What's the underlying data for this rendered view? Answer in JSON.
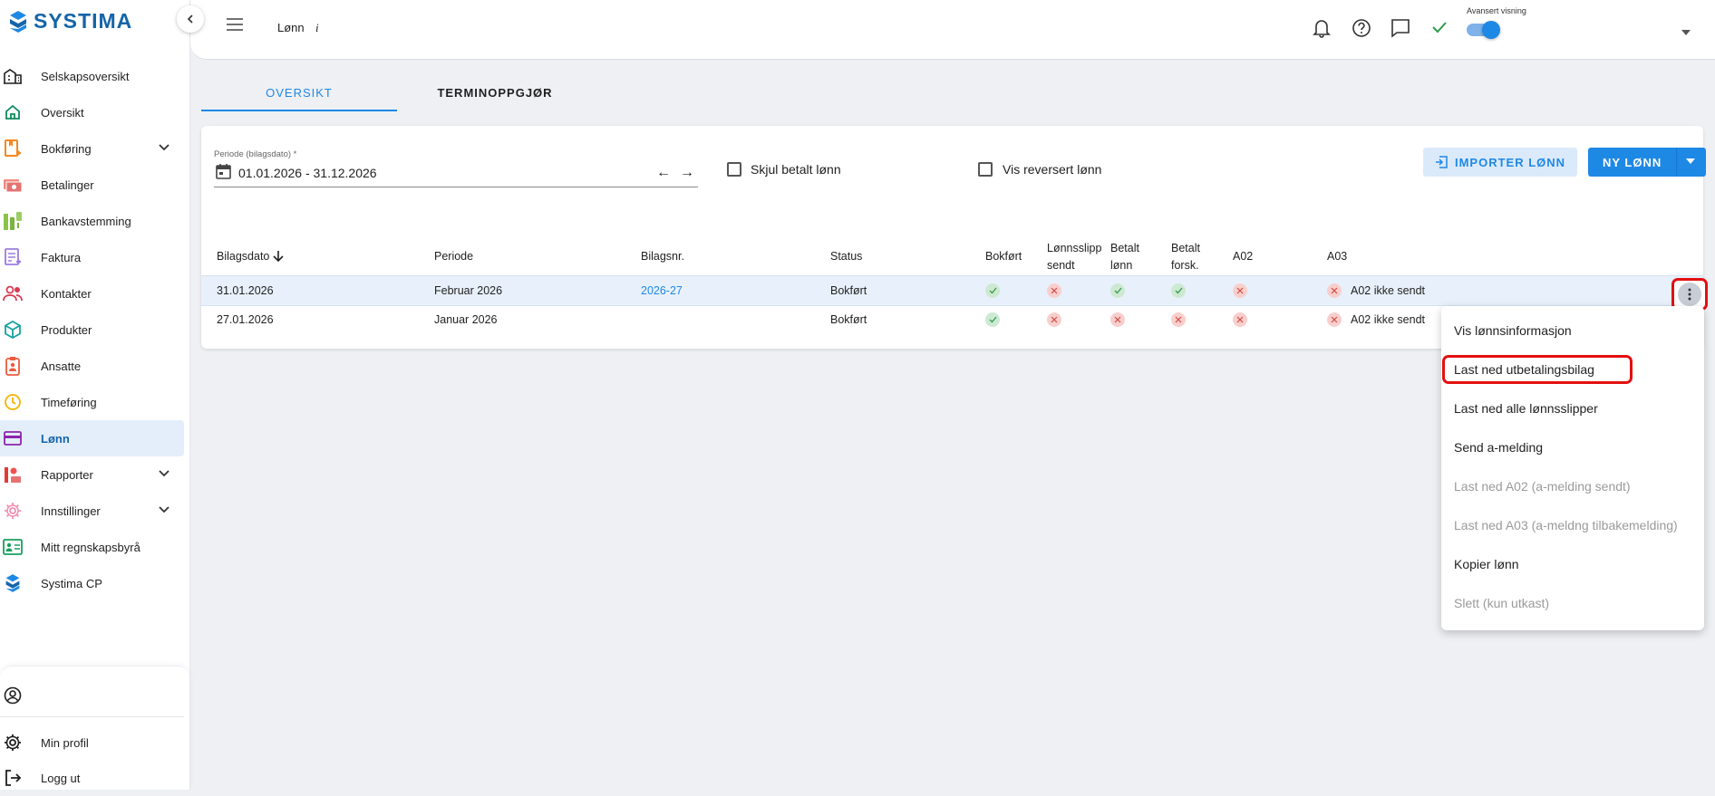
{
  "app": {
    "logo_text": "SYSTIMA",
    "accent_color": "#1e88e5"
  },
  "sidebar": {
    "items": [
      {
        "label": "Selskapsoversikt",
        "icon": "buildings-icon"
      },
      {
        "label": "Oversikt",
        "icon": "home-icon"
      },
      {
        "label": "Bokføring",
        "icon": "ledger-icon",
        "expandable": true
      },
      {
        "label": "Betalinger",
        "icon": "payments-icon"
      },
      {
        "label": "Bankavstemming",
        "icon": "bank-reconcile-icon"
      },
      {
        "label": "Faktura",
        "icon": "invoice-icon"
      },
      {
        "label": "Kontakter",
        "icon": "contacts-icon"
      },
      {
        "label": "Produkter",
        "icon": "cube-icon"
      },
      {
        "label": "Ansatte",
        "icon": "badge-icon"
      },
      {
        "label": "Timeføring",
        "icon": "clock-icon"
      },
      {
        "label": "Lønn",
        "icon": "card-icon",
        "active": true
      },
      {
        "label": "Rapporter",
        "icon": "chart-icon",
        "expandable": true
      },
      {
        "label": "Innstillinger",
        "icon": "gear-icon",
        "expandable": true
      },
      {
        "label": "Mitt regnskapsbyrå",
        "icon": "id-card-icon"
      },
      {
        "label": "Systima CP",
        "icon": "systima-icon"
      }
    ],
    "bottom": {
      "profile": "Min profil",
      "logout": "Logg ut"
    }
  },
  "header": {
    "title": "Lønn",
    "info": "i",
    "advanced_label": "Avansert visning",
    "advanced_on": true
  },
  "tabs": [
    {
      "label": "OVERSIKT",
      "active": true
    },
    {
      "label": "TERMINOPPGJØR",
      "active": false
    }
  ],
  "filters": {
    "period_label": "Periode (bilagsdato) *",
    "period_value": "01.01.2026 - 31.12.2026",
    "hide_paid_label": "Skjul betalt lønn",
    "show_reversed_label": "Vis reversert lønn",
    "import_button": "IMPORTER LØNN",
    "new_button": "NY LØNN"
  },
  "table": {
    "headers": {
      "bilagsdato": "Bilagsdato",
      "periode": "Periode",
      "bilagsnr": "Bilagsnr.",
      "status": "Status",
      "bokfort": "Bokført",
      "lonnsslipp_1": "Lønnsslipp",
      "lonnsslipp_2": "sendt",
      "betalt_lonn_1": "Betalt",
      "betalt_lonn_2": "lønn",
      "betalt_forsk_1": "Betalt",
      "betalt_forsk_2": "forsk.",
      "a02": "A02",
      "a03": "A03"
    },
    "rows": [
      {
        "bilagsdato": "31.01.2026",
        "periode": "Februar 2026",
        "bilagsnr": "2026-27",
        "status": "Bokført",
        "bokfort": true,
        "lonnsslipp": false,
        "betalt_lonn": true,
        "betalt_forsk": true,
        "a02": false,
        "a03": "A02 ikke sendt"
      },
      {
        "bilagsdato": "27.01.2026",
        "periode": "Januar 2026",
        "bilagsnr": "",
        "status": "Bokført",
        "bokfort": true,
        "lonnsslipp": false,
        "betalt_lonn": false,
        "betalt_forsk": false,
        "a02": false,
        "a03": "A02 ikke sendt"
      }
    ]
  },
  "menu": {
    "items": [
      {
        "label": "Vis lønnsinformasjon",
        "disabled": false
      },
      {
        "label": "Last ned utbetalingsbilag",
        "disabled": false
      },
      {
        "label": "Last ned alle lønnsslipper",
        "disabled": false
      },
      {
        "label": "Send a-melding",
        "disabled": false
      },
      {
        "label": "Last ned A02 (a-melding sendt)",
        "disabled": true
      },
      {
        "label": "Last ned A03 (a-meldng tilbakemelding)",
        "disabled": true
      },
      {
        "label": "Kopier lønn",
        "disabled": false
      },
      {
        "label": "Slett (kun utkast)",
        "disabled": true
      }
    ]
  }
}
